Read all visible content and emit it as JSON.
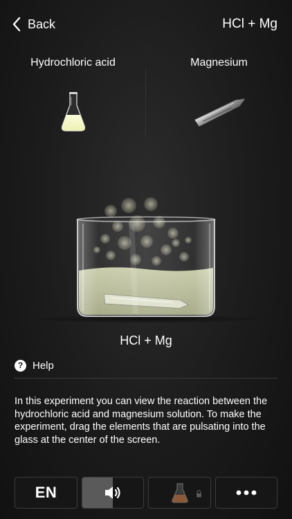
{
  "header": {
    "back_label": "Back",
    "title": "HCl + Mg"
  },
  "reagents": [
    {
      "label": "Hydrochloric acid",
      "icon": "flask-icon"
    },
    {
      "label": "Magnesium",
      "icon": "magnesium-strip-icon"
    }
  ],
  "reaction_label": "HCl + Mg",
  "help": {
    "label": "Help"
  },
  "description": "In this experiment you can view the reaction between the hydrochloric acid and magnesium solution. To make the experiment, drag the elements that are pulsating into the glass at the center of the screen.",
  "bottom_bar": {
    "language_label": "EN",
    "sound_icon": "speaker-icon",
    "sound_level": 0.5,
    "flask_icon": "flask-icon",
    "lock_icon": "lock-icon",
    "more_icon": "more-icon"
  },
  "colors": {
    "background": "#1b1b1b",
    "liquid": "#c9cfa6",
    "text": "#ffffff",
    "divider": "#3a3a3a"
  }
}
